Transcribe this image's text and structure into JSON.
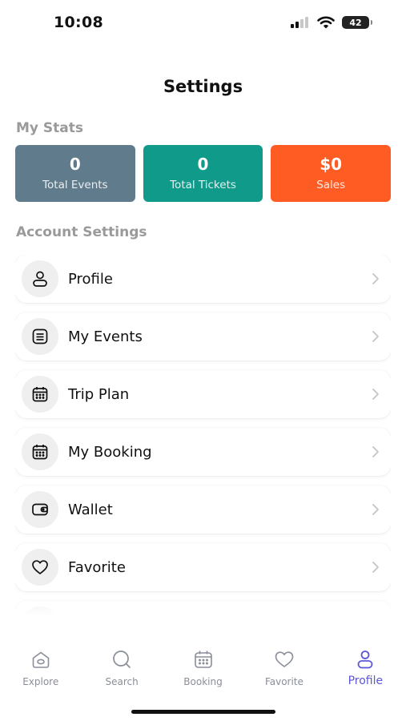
{
  "status_bar": {
    "time": "10:08",
    "battery": "42"
  },
  "page": {
    "title": "Settings"
  },
  "stats": {
    "section_title": "My Stats",
    "cards": [
      {
        "value": "0",
        "label": "Total Events",
        "color": "#5f7b8c"
      },
      {
        "value": "0",
        "label": "Total Tickets",
        "color": "#0f9a8a"
      },
      {
        "value": "$0",
        "label": "Sales",
        "color": "#ff5c24"
      }
    ]
  },
  "account": {
    "section_title": "Account Settings",
    "items": [
      {
        "label": "Profile",
        "icon": "user-icon"
      },
      {
        "label": "My Events",
        "icon": "list-icon"
      },
      {
        "label": "Trip Plan",
        "icon": "calendar-icon"
      },
      {
        "label": "My Booking",
        "icon": "calendar-icon"
      },
      {
        "label": "Wallet",
        "icon": "wallet-icon"
      },
      {
        "label": "Favorite",
        "icon": "heart-icon"
      }
    ]
  },
  "tabs": [
    {
      "label": "Explore",
      "icon": "home-icon",
      "active": false
    },
    {
      "label": "Search",
      "icon": "search-icon",
      "active": false
    },
    {
      "label": "Booking",
      "icon": "calendar-icon",
      "active": false
    },
    {
      "label": "Favorite",
      "icon": "heart-icon",
      "active": false
    },
    {
      "label": "Profile",
      "icon": "user-icon",
      "active": true
    }
  ],
  "colors": {
    "accent": "#5b57d6",
    "inactive_tab": "#8a8e98",
    "section_title": "#9a9a9a"
  }
}
